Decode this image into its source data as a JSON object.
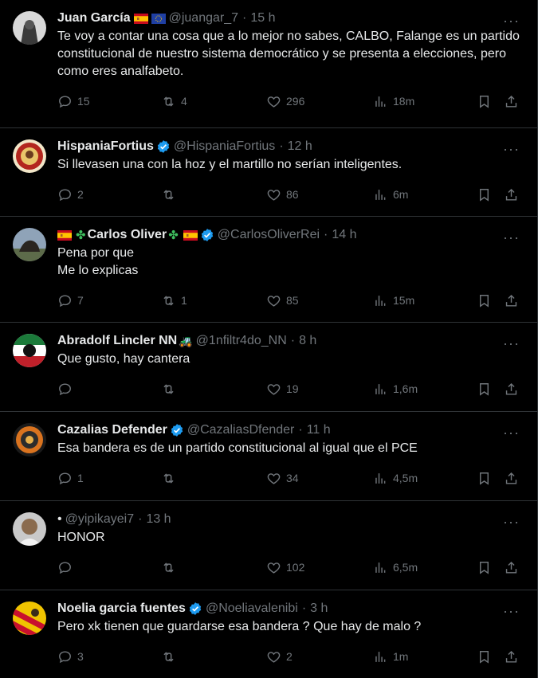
{
  "tweets": [
    {
      "name": "Juan García",
      "handle": "@juangar_7",
      "time": "15 h",
      "text": "Te voy a contar una cosa que a lo mejor no sabes, CALBO, Falange es un partido constitucional de nuestro sistema democrático y se presenta a elecciones, pero como eres analfabeto.",
      "replies": "15",
      "retweets": "4",
      "likes": "296",
      "views": "18m"
    },
    {
      "name": "HispaniaFortius",
      "handle": "@HispaniaFortius",
      "time": "12 h",
      "text": "Si llevasen una con la hoz y el martillo no serían inteligentes.",
      "replies": "2",
      "retweets": "",
      "likes": "86",
      "views": "6m"
    },
    {
      "name": "Carlos Oliver",
      "handle": "@CarlosOliverRei",
      "time": "14 h",
      "text": "Pena por que\nMe lo explicas",
      "replies": "7",
      "retweets": "1",
      "likes": "85",
      "views": "15m"
    },
    {
      "name": "Abradolf Lincler NN",
      "handle": "@1nfiltr4do_NN",
      "time": "8 h",
      "text": "Que gusto, hay cantera",
      "replies": "",
      "retweets": "",
      "likes": "19",
      "views": "1,6m"
    },
    {
      "name": "Cazalias Defender",
      "handle": "@CazaliasDfender",
      "time": "11 h",
      "text": "Esa bandera es de un partido constitucional al igual que el PCE",
      "replies": "1",
      "retweets": "",
      "likes": "34",
      "views": "4,5m"
    },
    {
      "name": "•",
      "handle": "@yipikayei7",
      "time": "13 h",
      "text": "HONOR",
      "replies": "",
      "retweets": "",
      "likes": "102",
      "views": "6,5m"
    },
    {
      "name": "Noelia garcia fuentes",
      "handle": "@Noeliavalenibi",
      "time": "3 h",
      "text": "Pero xk tienen que guardarse esa bandera ? Que hay de malo ?",
      "replies": "3",
      "retweets": "",
      "likes": "2",
      "views": "1m"
    }
  ],
  "more_label": "···",
  "dot": "·",
  "colors": {
    "background": "#000000",
    "text": "#e7e9ea",
    "muted": "#71767b",
    "divider": "#2f3336",
    "verified": "#1d9bf0"
  }
}
